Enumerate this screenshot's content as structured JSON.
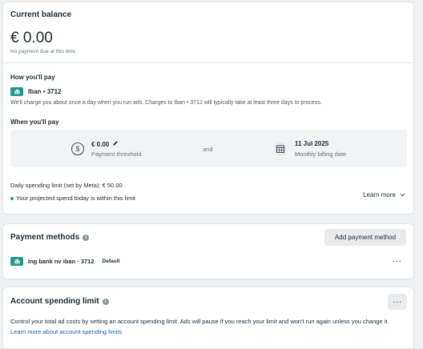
{
  "balance": {
    "title": "Current balance",
    "amount": "€ 0.00",
    "note": "No payment due at this time."
  },
  "how_pay": {
    "heading": "How you'll pay",
    "method_label": "Iban • 3712",
    "description": "We'll charge you about once a day when you run ads. Charges to Iban • 3712 will typically take at least three days to process."
  },
  "when_pay": {
    "heading": "When you'll pay",
    "threshold_value": "€ 0.00",
    "threshold_label": "Payment threshold",
    "connector": "and",
    "billing_date": "11 Jul 2025",
    "billing_label": "Monthly billing date"
  },
  "daily_limit": {
    "text": "Daily spending limit (set by Meta): € 50.00",
    "status": "Your projected spend today is within this limit",
    "learn_more": "Learn more"
  },
  "payment_methods": {
    "title": "Payment methods",
    "add_button": "Add payment method",
    "method_name": "Ing bank nv iban · 3712",
    "badge": "Default",
    "more": "···"
  },
  "spending_limit": {
    "title": "Account spending limit",
    "more": "···",
    "description": "Control your total ad costs by setting an account spending limit. Ads will pause if you reach your limit and won't run again unless you change it.",
    "link": "Learn more about account spending limits"
  },
  "colors": {
    "bank_icon": "#1f9b8a",
    "status_dot": "#31a24c",
    "link": "#1b5fb6"
  }
}
